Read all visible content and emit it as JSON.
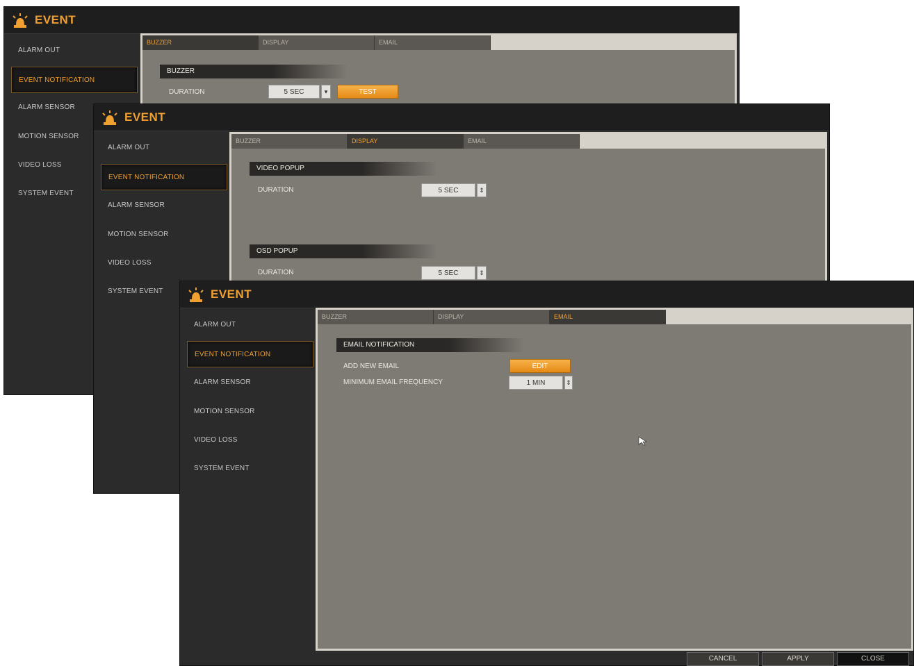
{
  "window_title": "EVENT",
  "sidebar_items": [
    "ALARM OUT",
    "EVENT NOTIFICATION",
    "ALARM SENSOR",
    "MOTION SENSOR",
    "VIDEO LOSS",
    "SYSTEM EVENT"
  ],
  "tabs": [
    "BUZZER",
    "DISPLAY",
    "EMAIL"
  ],
  "buzzer": {
    "section": "BUZZER",
    "duration_label": "DURATION",
    "duration_value": "5 SEC",
    "test_label": "TEST"
  },
  "display": {
    "video_popup_section": "VIDEO POPUP",
    "video_duration_label": "DURATION",
    "video_duration_value": "5 SEC",
    "osd_popup_section": "OSD POPUP",
    "osd_duration_label": "DURATION",
    "osd_duration_value": "5 SEC"
  },
  "email": {
    "section": "EMAIL NOTIFICATION",
    "add_new_label": "ADD NEW EMAIL",
    "edit_label": "EDIT",
    "min_freq_label": "MINIMUM EMAIL FREQUENCY",
    "min_freq_value": "1 MIN"
  },
  "footer": {
    "cancel": "CANCEL",
    "apply": "APPLY",
    "close": "CLOSE"
  },
  "colors": {
    "accent": "#f0a030",
    "panel": "#7e7a74",
    "window": "#2b2b2b"
  }
}
